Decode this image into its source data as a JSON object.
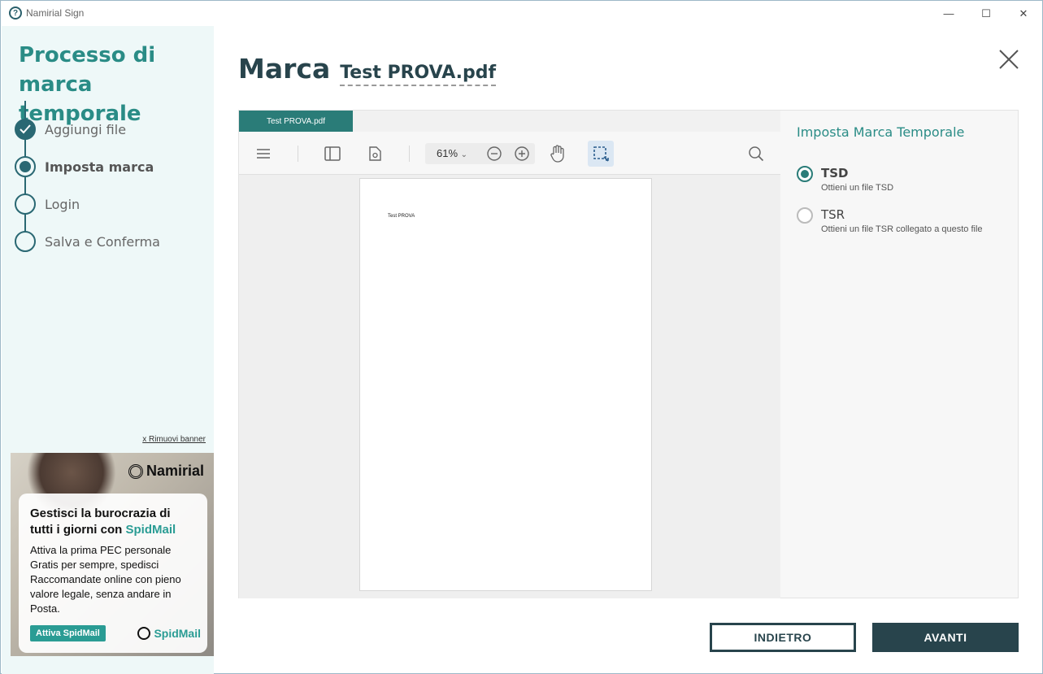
{
  "window": {
    "app_title": "Namirial Sign",
    "logo_glyph": "?",
    "controls": {
      "minimize": "—",
      "maximize": "☐",
      "close": "✕"
    }
  },
  "sidebar": {
    "title": "Processo di marca temporale",
    "steps": [
      {
        "label": "Aggiungi file",
        "state": "done"
      },
      {
        "label": "Imposta marca",
        "state": "active"
      },
      {
        "label": "Login",
        "state": "pending"
      },
      {
        "label": "Salva e Conferma",
        "state": "pending"
      }
    ],
    "remove_banner": "x Rimuovi banner",
    "banner": {
      "brand": "Namirial",
      "headline_1": "Gestisci la burocrazia di tutti i giorni con ",
      "headline_highlight": "SpidMail",
      "body": "Attiva la prima PEC personale Gratis per sempre, spedisci Raccomandate online con pieno valore legale, senza andare in Posta.",
      "cta": "Attiva SpidMail",
      "product": "SpidMail"
    }
  },
  "main": {
    "title": "Marca",
    "filename": "Test PROVA.pdf"
  },
  "viewer": {
    "tab_label": "Test PROVA.pdf",
    "zoom": "61%",
    "page_text": "Test PROVA"
  },
  "options": {
    "title": "Imposta Marca Temporale",
    "items": [
      {
        "label": "TSD",
        "sub": "Ottieni un file TSD",
        "checked": true
      },
      {
        "label": "TSR",
        "sub": "Ottieni un file TSR collegato a questo file",
        "checked": false
      }
    ]
  },
  "footer": {
    "back_label": "INDIETRO",
    "next_label": "AVANTI"
  },
  "colors": {
    "accent": "#2a8c86",
    "dark": "#28444c",
    "sidebar_bg": "#eef8f8"
  }
}
